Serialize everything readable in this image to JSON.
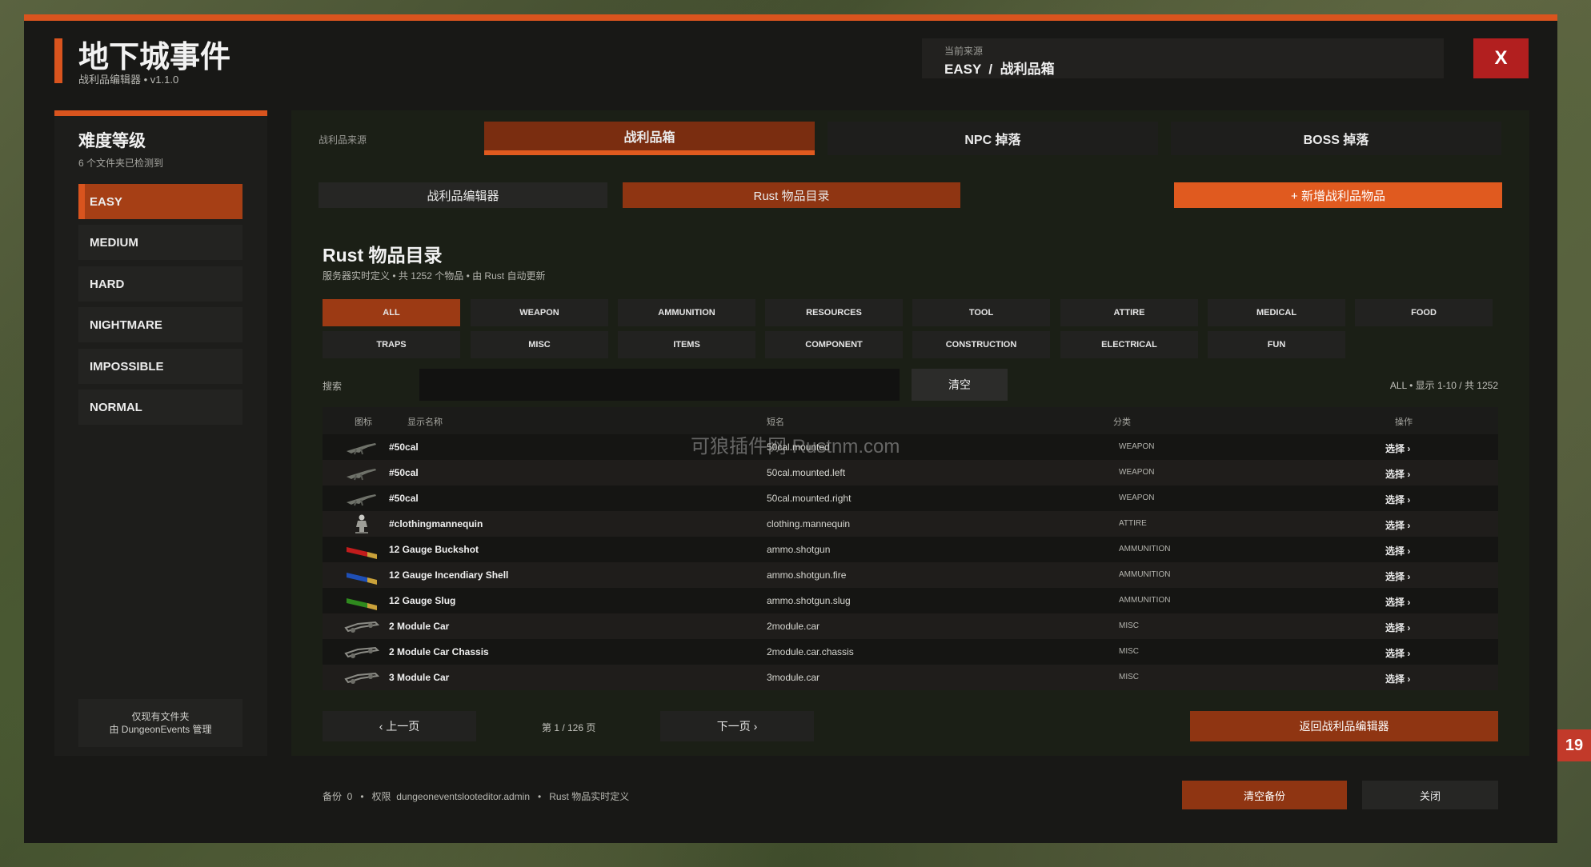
{
  "app": {
    "title": "地下城事件",
    "subtitle": "战利品编辑器 • v1.1.0"
  },
  "source": {
    "caption": "当前来源",
    "path": "EASY  /  战利品箱"
  },
  "close_label": "X",
  "sidebar": {
    "title": "难度等级",
    "note": "6 个文件夹已检测到",
    "items": [
      {
        "label": "EASY"
      },
      {
        "label": "MEDIUM"
      },
      {
        "label": "HARD"
      },
      {
        "label": "NIGHTMARE"
      },
      {
        "label": "IMPOSSIBLE"
      },
      {
        "label": "NORMAL"
      }
    ],
    "footer_line1": "仅现有文件夹",
    "footer_line2": "由 DungeonEvents 管理"
  },
  "source_tabs": {
    "label": "战利品来源",
    "tabs": [
      {
        "label": "战利品箱"
      },
      {
        "label": "NPC 掉落"
      },
      {
        "label": "BOSS 掉落"
      }
    ]
  },
  "sub_tabs": {
    "editor": "战利品编辑器",
    "catalog": "Rust 物品目录",
    "add_item": "+  新增战利品物品"
  },
  "catalog": {
    "title": "Rust 物品目录",
    "subtitle": "服务器实时定义 • 共 1252 个物品 • 由 Rust 自动更新",
    "categories": [
      "ALL",
      "WEAPON",
      "AMMUNITION",
      "RESOURCES",
      "TOOL",
      "ATTIRE",
      "MEDICAL",
      "FOOD",
      "TRAPS",
      "MISC",
      "ITEMS",
      "COMPONENT",
      "CONSTRUCTION",
      "ELECTRICAL",
      "FUN"
    ],
    "search_label": "搜索",
    "search_value": "",
    "clear_label": "清空",
    "count_text": "ALL • 显示 1-10 / 共 1252"
  },
  "table": {
    "headers": {
      "icon": "图标",
      "name": "显示名称",
      "short": "短名",
      "category": "分类",
      "action": "操作"
    },
    "rows": [
      {
        "icon": "mounted-gun-icon",
        "name": "#50cal",
        "short": "50cal.mounted",
        "category": "WEAPON",
        "action": "选择 ›"
      },
      {
        "icon": "mounted-gun-icon",
        "name": "#50cal",
        "short": "50cal.mounted.left",
        "category": "WEAPON",
        "action": "选择 ›"
      },
      {
        "icon": "mounted-gun-icon",
        "name": "#50cal",
        "short": "50cal.mounted.right",
        "category": "WEAPON",
        "action": "选择 ›"
      },
      {
        "icon": "mannequin-icon",
        "name": "#clothingmannequin",
        "short": "clothing.mannequin",
        "category": "ATTIRE",
        "action": "选择 ›"
      },
      {
        "icon": "shell-red-icon",
        "name": "12 Gauge Buckshot",
        "short": "ammo.shotgun",
        "category": "AMMUNITION",
        "action": "选择 ›"
      },
      {
        "icon": "shell-blue-icon",
        "name": "12 Gauge Incendiary Shell",
        "short": "ammo.shotgun.fire",
        "category": "AMMUNITION",
        "action": "选择 ›"
      },
      {
        "icon": "shell-green-icon",
        "name": "12 Gauge Slug",
        "short": "ammo.shotgun.slug",
        "category": "AMMUNITION",
        "action": "选择 ›"
      },
      {
        "icon": "car-frame-icon",
        "name": "2 Module Car",
        "short": "2module.car",
        "category": "MISC",
        "action": "选择 ›"
      },
      {
        "icon": "car-frame-icon",
        "name": "2 Module Car Chassis",
        "short": "2module.car.chassis",
        "category": "MISC",
        "action": "选择 ›"
      },
      {
        "icon": "car-frame-icon",
        "name": "3 Module Car",
        "short": "3module.car",
        "category": "MISC",
        "action": "选择 ›"
      }
    ]
  },
  "pager": {
    "prev": "‹ 上一页",
    "info": "第 1 / 126 页",
    "next": "下一页 ›",
    "back": "返回战利品编辑器"
  },
  "footer": {
    "info": "备份  0   •   权限  dungeoneventslooteditor.admin   •   Rust 物品实时定义",
    "clear_backup": "清空备份",
    "close": "关闭"
  },
  "watermark": "可狼插件网  Rustnm.com",
  "side_badge": "19",
  "colors": {
    "accent": "#d9541e",
    "active": "#9c3a14",
    "close": "#b21f1f"
  }
}
